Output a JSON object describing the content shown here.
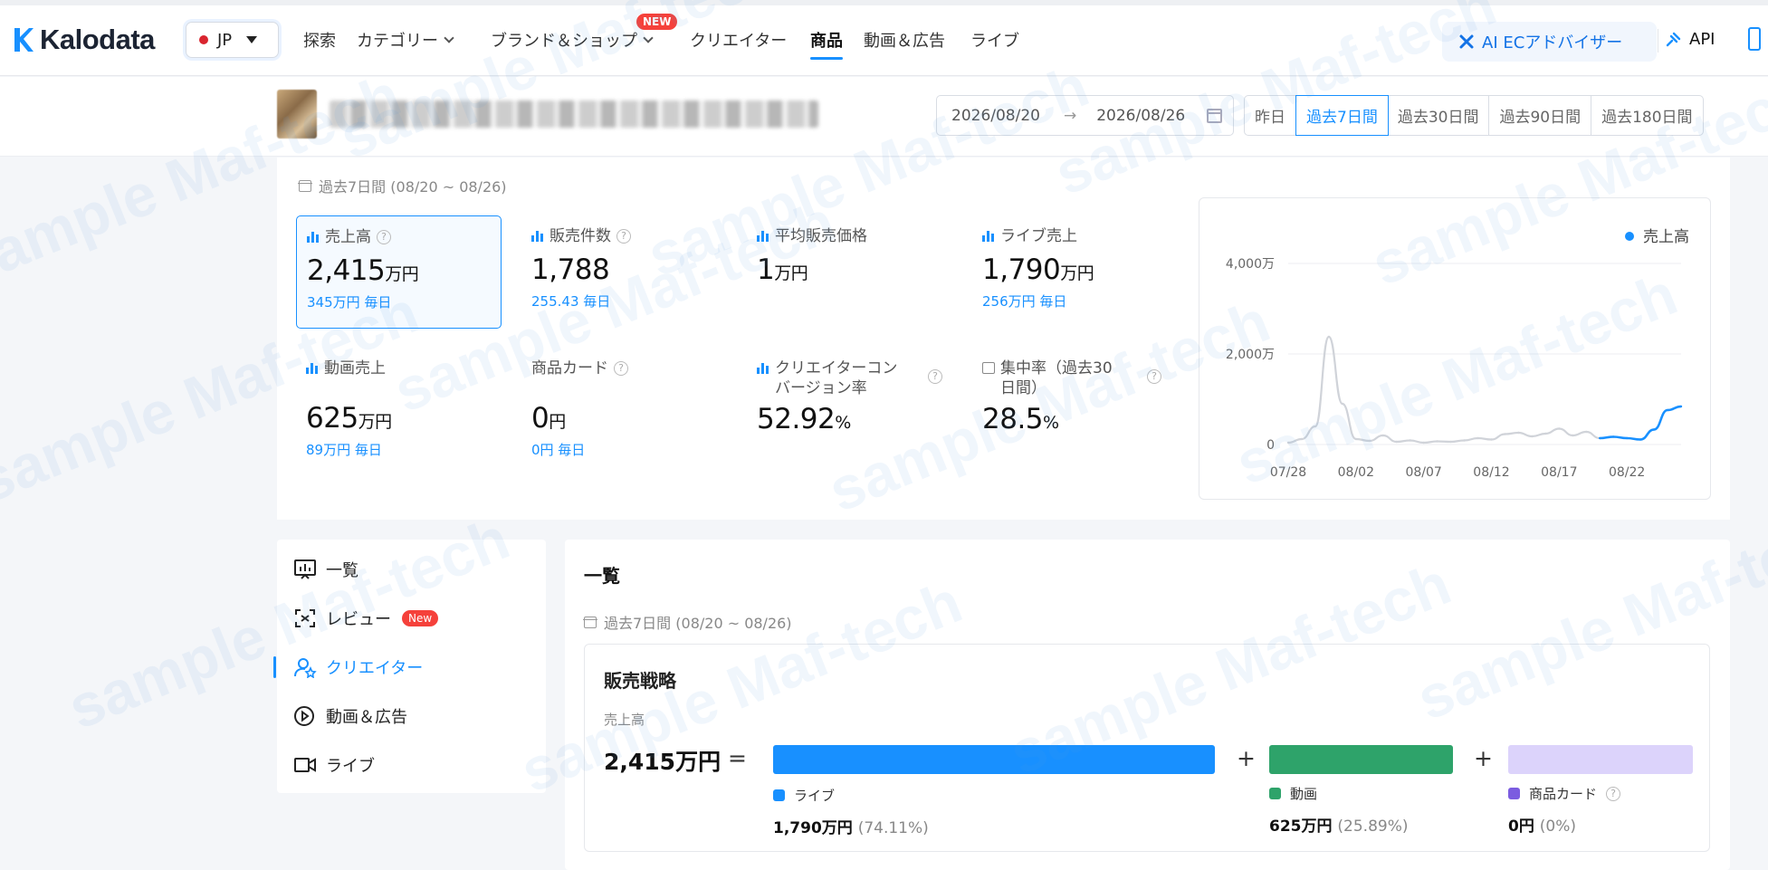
{
  "header": {
    "brand": "Kalodata",
    "country": "JP",
    "nav": [
      {
        "label": "探索"
      },
      {
        "label": "カテゴリー"
      },
      {
        "label": "ブランド＆ショップ"
      },
      {
        "label": "クリエイター"
      },
      {
        "label": "商品"
      },
      {
        "label": "動画＆広告"
      },
      {
        "label": "ライブ"
      }
    ],
    "new_badge": "NEW",
    "ai_button": "AI ECアドバイザー",
    "api": "API"
  },
  "date_filter": {
    "start": "2026/08/20",
    "arrow": "→",
    "end": "2026/08/26",
    "quick_options": [
      "昨日",
      "過去7日間",
      "過去30日間",
      "過去90日間",
      "過去180日間"
    ],
    "selected": "過去7日間"
  },
  "metrics": {
    "period": "過去7日間 (08/20 ~ 08/26)",
    "items": [
      {
        "label": "売上高",
        "value": "2,415",
        "unit": "万円",
        "sub": "345万円 毎日"
      },
      {
        "label": "販売件数",
        "value": "1,788",
        "unit": "",
        "sub": "255.43 毎日"
      },
      {
        "label": "平均販売価格",
        "value": "1",
        "unit": "万円",
        "sub": ""
      },
      {
        "label": "ライブ売上",
        "value": "1,790",
        "unit": "万円",
        "sub": "256万円 毎日"
      },
      {
        "label": "動画売上",
        "value": "625",
        "unit": "万円",
        "sub": "89万円 毎日"
      },
      {
        "label": "商品カード",
        "value": "0",
        "unit": "円",
        "sub": "0円 毎日"
      },
      {
        "label": "クリエイターコンバージョン率",
        "value": "52.92",
        "unit": "%",
        "sub": ""
      },
      {
        "label": "集中率（過去30日間）",
        "value": "28.5",
        "unit": "%",
        "sub": ""
      }
    ]
  },
  "chart_data": {
    "type": "line",
    "legend": "売上高",
    "y_ticks": [
      "4,000万",
      "2,000万",
      "0"
    ],
    "ylim": [
      0,
      4000
    ],
    "x_ticks": [
      "07/28",
      "08/02",
      "08/07",
      "08/12",
      "08/17",
      "08/22"
    ],
    "x": [
      "07/28",
      "07/29",
      "07/30",
      "07/31",
      "08/01",
      "08/02",
      "08/03",
      "08/04",
      "08/05",
      "08/06",
      "08/07",
      "08/08",
      "08/09",
      "08/10",
      "08/11",
      "08/12",
      "08/13",
      "08/14",
      "08/15",
      "08/16",
      "08/17",
      "08/18",
      "08/19",
      "08/20",
      "08/21",
      "08/22",
      "08/23",
      "08/24",
      "08/25",
      "08/26"
    ],
    "values": [
      40,
      120,
      400,
      2380,
      900,
      120,
      80,
      200,
      60,
      90,
      40,
      70,
      60,
      90,
      140,
      110,
      230,
      260,
      180,
      240,
      350,
      200,
      280,
      140,
      170,
      140,
      110,
      330,
      760,
      840
    ],
    "highlight_from": "08/20",
    "colors": {
      "highlight": "#1890ff",
      "base": "#d0d3d9"
    }
  },
  "sidebar": {
    "items": [
      {
        "label": "一覧"
      },
      {
        "label": "レビュー",
        "badge": "New"
      },
      {
        "label": "クリエイター"
      },
      {
        "label": "動画＆広告"
      },
      {
        "label": "ライブ"
      }
    ]
  },
  "main": {
    "title": "一覧",
    "period": "過去7日間 (08/20 ~ 08/26)",
    "strategy": {
      "title": "販売戦略",
      "metric": "売上高",
      "total": "2,415万円",
      "eq": "=",
      "plus": "+",
      "segments": [
        {
          "name": "ライブ",
          "value": "1,790万円",
          "pct": "(74.11%)",
          "color": "#1890ff"
        },
        {
          "name": "動画",
          "value": "625万円",
          "pct": "(25.89%)",
          "color": "#2ea36a"
        },
        {
          "name": "商品カード",
          "value": "0円",
          "pct": "(0%)",
          "color": "#7b5ce0"
        }
      ]
    }
  },
  "watermark": "sample Maf-tech"
}
